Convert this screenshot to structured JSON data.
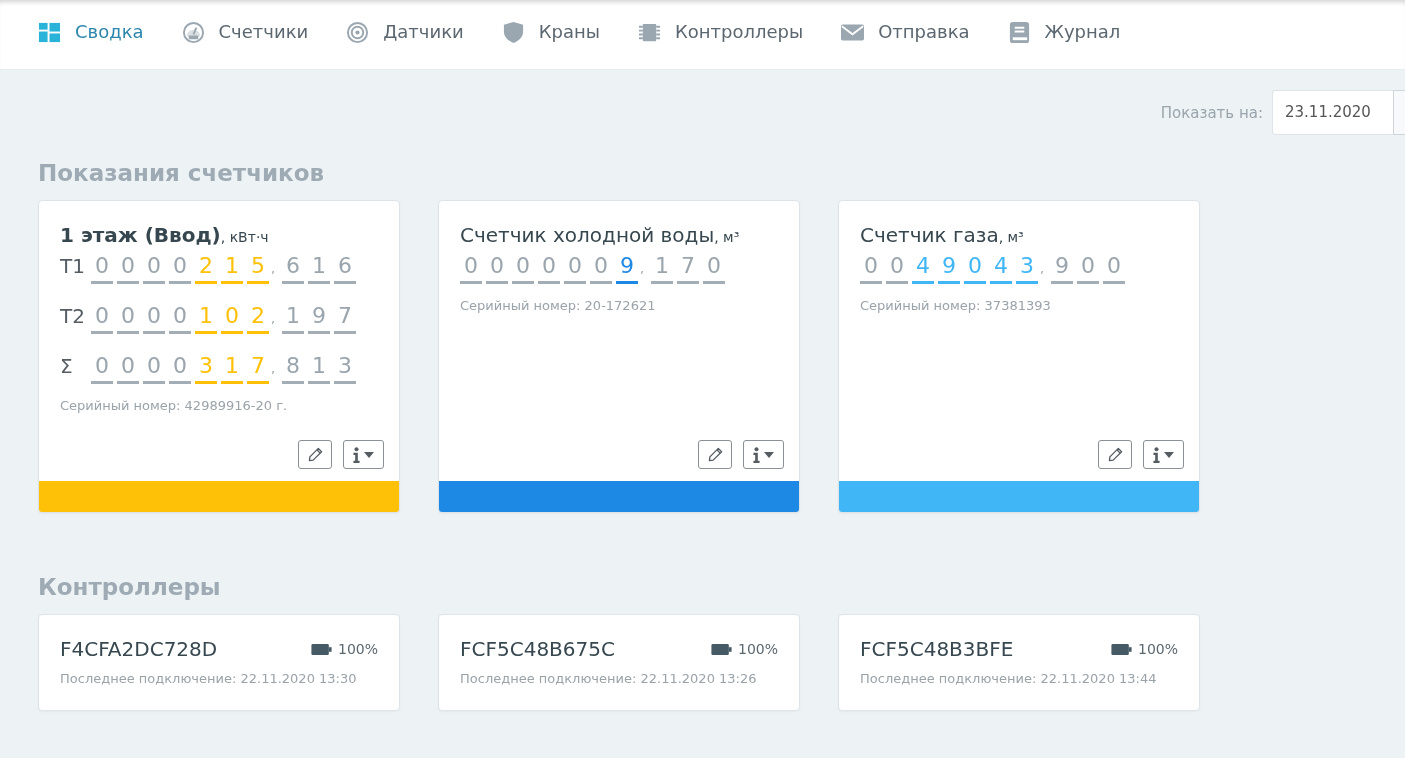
{
  "nav": {
    "items": [
      {
        "label": "Сводка",
        "selected": true
      },
      {
        "label": "Счетчики",
        "selected": false
      },
      {
        "label": "Датчики",
        "selected": false
      },
      {
        "label": "Краны",
        "selected": false
      },
      {
        "label": "Контроллеры",
        "selected": false
      },
      {
        "label": "Отправка",
        "selected": false
      },
      {
        "label": "Журнал",
        "selected": false
      }
    ]
  },
  "date_filter": {
    "label": "Показать на:",
    "value": "23.11.2020"
  },
  "meters_section": {
    "title": "Показания счетчиков",
    "meters": [
      {
        "title": "1 этаж (Ввод)",
        "emphasized": true,
        "unit": ", кВт·ч",
        "color": "#ffc107",
        "rows": [
          {
            "label": "T1",
            "digits": [
              {
                "digit": "0",
                "highlighted": false
              },
              {
                "digit": "0",
                "highlighted": false
              },
              {
                "digit": "0",
                "highlighted": false
              },
              {
                "digit": "0",
                "highlighted": false
              },
              {
                "digit": "2",
                "highlighted": true
              },
              {
                "digit": "1",
                "highlighted": true
              },
              {
                "digit": "5",
                "highlighted": true
              }
            ],
            "separator": ",",
            "decimals": [
              "6",
              "1",
              "6"
            ]
          },
          {
            "label": "T2",
            "digits": [
              {
                "digit": "0",
                "highlighted": false
              },
              {
                "digit": "0",
                "highlighted": false
              },
              {
                "digit": "0",
                "highlighted": false
              },
              {
                "digit": "0",
                "highlighted": false
              },
              {
                "digit": "1",
                "highlighted": true
              },
              {
                "digit": "0",
                "highlighted": true
              },
              {
                "digit": "2",
                "highlighted": true
              }
            ],
            "separator": ",",
            "decimals": [
              "1",
              "9",
              "7"
            ]
          },
          {
            "label": "Σ",
            "digits": [
              {
                "digit": "0",
                "highlighted": false
              },
              {
                "digit": "0",
                "highlighted": false
              },
              {
                "digit": "0",
                "highlighted": false
              },
              {
                "digit": "0",
                "highlighted": false
              },
              {
                "digit": "3",
                "highlighted": true
              },
              {
                "digit": "1",
                "highlighted": true
              },
              {
                "digit": "7",
                "highlighted": true
              }
            ],
            "separator": ",",
            "decimals": [
              "8",
              "1",
              "3"
            ]
          }
        ],
        "serial": "Серийный номер: 42989916-20 г."
      },
      {
        "title": "Счетчик холодной воды",
        "emphasized": false,
        "unit": ", м³",
        "color": "#1e88e5",
        "rows": [
          {
            "digits": [
              {
                "digit": "0",
                "highlighted": false
              },
              {
                "digit": "0",
                "highlighted": false
              },
              {
                "digit": "0",
                "highlighted": false
              },
              {
                "digit": "0",
                "highlighted": false
              },
              {
                "digit": "0",
                "highlighted": false
              },
              {
                "digit": "0",
                "highlighted": false
              },
              {
                "digit": "9",
                "highlighted": true
              }
            ],
            "separator": ",",
            "decimals": [
              "1",
              "7",
              "0"
            ]
          }
        ],
        "serial": "Серийный номер: 20-172621"
      },
      {
        "title": "Счетчик газа",
        "emphasized": false,
        "unit": ", м³",
        "color": "#40b6f6",
        "rows": [
          {
            "digits": [
              {
                "digit": "0",
                "highlighted": false
              },
              {
                "digit": "0",
                "highlighted": false
              },
              {
                "digit": "4",
                "highlighted": true
              },
              {
                "digit": "9",
                "highlighted": true
              },
              {
                "digit": "0",
                "highlighted": true
              },
              {
                "digit": "4",
                "highlighted": true
              },
              {
                "digit": "3",
                "highlighted": true
              }
            ],
            "separator": ",",
            "decimals": [
              "9",
              "0",
              "0"
            ]
          }
        ],
        "serial": "Серийный номер: 37381393"
      }
    ]
  },
  "controllers_section": {
    "title": "Контроллеры",
    "controllers": [
      {
        "id": "F4CFA2DC728D",
        "battery": "100%",
        "last_connection": "Последнее подключение: 22.11.2020 13:30"
      },
      {
        "id": "FCF5C48B675C",
        "battery": "100%",
        "last_connection": "Последнее подключение: 22.11.2020 13:26"
      },
      {
        "id": "FCF5C48B3BFE",
        "battery": "100%",
        "last_connection": "Последнее подключение: 22.11.2020 13:44"
      }
    ]
  }
}
